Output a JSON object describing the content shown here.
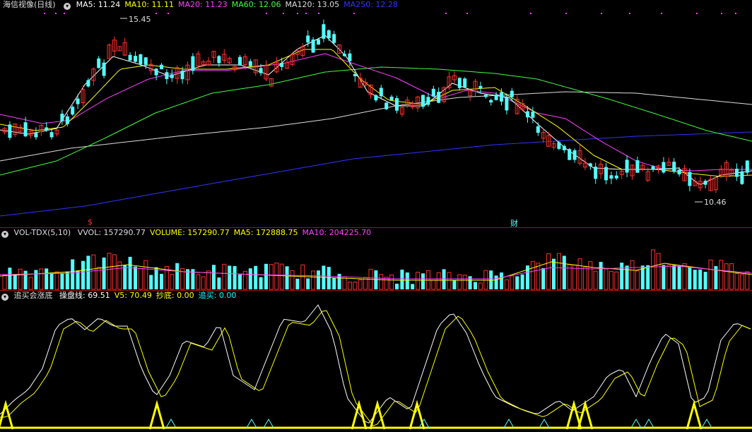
{
  "price_panel": {
    "title": "海信视像(日线)",
    "ma_labels": [
      {
        "text": "MA5: 11.24",
        "color": "#ffffff"
      },
      {
        "text": "MA10: 11.11",
        "color": "#ffff00"
      },
      {
        "text": "MA20: 11.23",
        "color": "#ff40ff"
      },
      {
        "text": "MA60: 12.06",
        "color": "#40ff40"
      },
      {
        "text": "MA120: 13.05",
        "color": "#dddddd"
      },
      {
        "text": "MA250: 12.28",
        "color": "#3333ff"
      }
    ],
    "high_label": "15.45",
    "low_label": "10.46",
    "event_marker": "$",
    "finance_marker": "财"
  },
  "volume_panel": {
    "title": "VOL-TDX(5,10)",
    "labels": [
      {
        "text": "VVOL: 157290.77",
        "color": "#dddddd"
      },
      {
        "text": "VOLUME: 157290.77",
        "color": "#ffff00"
      },
      {
        "text": "MA5: 172888.75",
        "color": "#ffff00"
      },
      {
        "text": "MA10: 204225.70",
        "color": "#ff40ff"
      }
    ]
  },
  "indicator_panel": {
    "title": "追买会涨底",
    "labels": [
      {
        "text": "操盘线: 69.51",
        "color": "#ffffff"
      },
      {
        "text": "V5: 70.49",
        "color": "#ffff00"
      },
      {
        "text": "抄底: 0.00",
        "color": "#ffff00"
      },
      {
        "text": "追买: 0.00",
        "color": "#00ffff"
      }
    ]
  },
  "colors": {
    "up": "#ff3030",
    "down": "#54ffff",
    "ma5": "#ffffff",
    "ma10": "#ffff00",
    "ma20": "#ff40ff",
    "ma60": "#40ff40",
    "ma120": "#dddddd",
    "ma250": "#3333ff",
    "divider": "#a01010"
  }
}
